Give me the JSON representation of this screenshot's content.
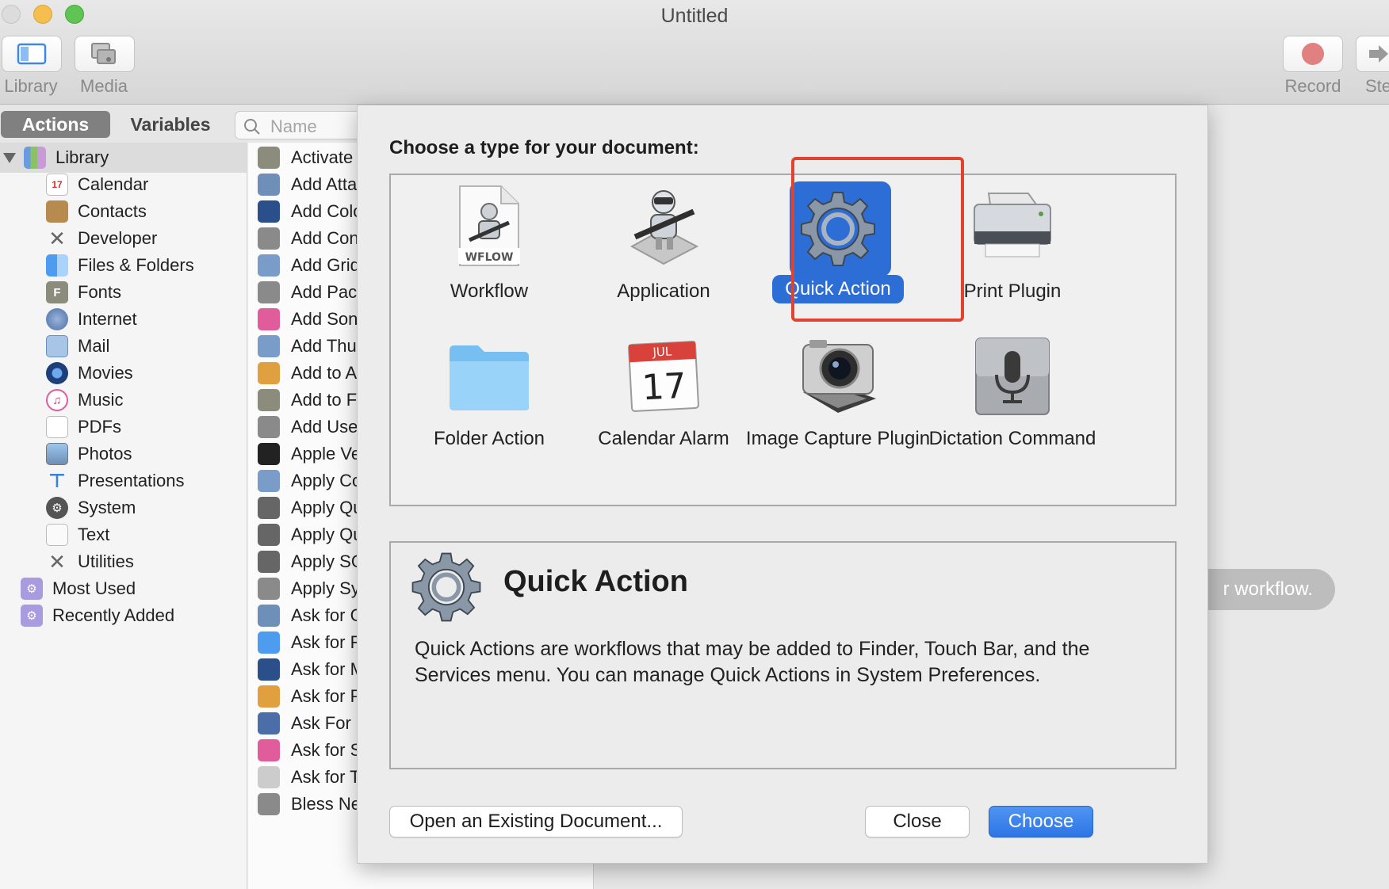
{
  "window": {
    "title": "Untitled"
  },
  "toolbar": {
    "library_label": "Library",
    "media_label": "Media",
    "record_label": "Record",
    "step_label": "Ste"
  },
  "sidebar": {
    "tabs": {
      "actions": "Actions",
      "variables": "Variables"
    },
    "search_placeholder": "Name",
    "library_root": "Library",
    "categories": [
      "Calendar",
      "Contacts",
      "Developer",
      "Files & Folders",
      "Fonts",
      "Internet",
      "Mail",
      "Movies",
      "Music",
      "PDFs",
      "Photos",
      "Presentations",
      "System",
      "Text",
      "Utilities"
    ],
    "smart_groups": [
      "Most Used",
      "Recently Added"
    ]
  },
  "actions_list": [
    "Activate",
    "Add Atta",
    "Add Colo",
    "Add Con",
    "Add Grid",
    "Add Pac",
    "Add Son",
    "Add Thu",
    "Add to A",
    "Add to F",
    "Add Use",
    "Apple Ve",
    "Apply Co",
    "Apply Qu",
    "Apply Qu",
    "Apply SQ",
    "Apply Sy",
    "Ask for C",
    "Ask for F",
    "Ask for M",
    "Ask for P",
    "Ask For",
    "Ask for S",
    "Ask for T",
    "Bless NetBoot Image Folder"
  ],
  "workflow_hint": "r workflow.",
  "dialog": {
    "heading": "Choose a type for your document:",
    "types": [
      {
        "label": "Workflow",
        "icon": "workflow-document-icon",
        "badge": "WFLOW"
      },
      {
        "label": "Application",
        "icon": "automator-robot-icon"
      },
      {
        "label": "Quick Action",
        "icon": "gear-icon",
        "selected": true
      },
      {
        "label": "Print Plugin",
        "icon": "printer-icon"
      },
      {
        "label": "Folder Action",
        "icon": "folder-icon"
      },
      {
        "label": "Calendar Alarm",
        "icon": "calendar-icon",
        "month": "JUL",
        "day": "17"
      },
      {
        "label": "Image Capture Plugin",
        "icon": "camera-icon"
      },
      {
        "label": "Dictation Command",
        "icon": "microphone-icon"
      }
    ],
    "description": {
      "title": "Quick Action",
      "text": "Quick Actions are workflows that may be added to Finder, Touch Bar, and the Services menu. You can manage Quick Actions in System Preferences."
    },
    "buttons": {
      "open_existing": "Open an Existing Document...",
      "close": "Close",
      "choose": "Choose"
    }
  },
  "colors": {
    "accent": "#2d6ed6",
    "highlight_frame": "#e0442e"
  }
}
